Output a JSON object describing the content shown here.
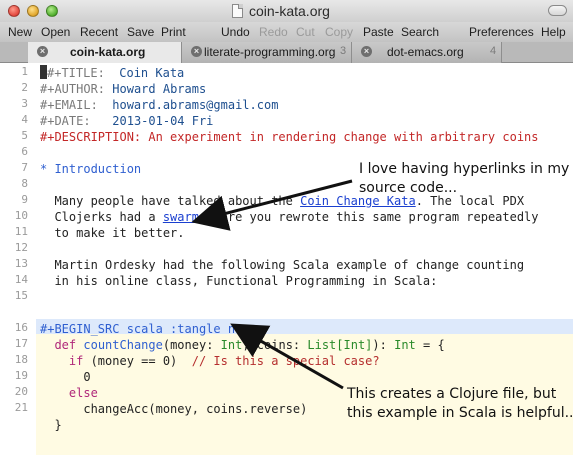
{
  "window": {
    "title": "coin-kata.org"
  },
  "toolbar": {
    "items": [
      {
        "label": "New",
        "enabled": true
      },
      {
        "label": "Open",
        "enabled": true
      },
      {
        "label": "Recent",
        "enabled": true
      },
      {
        "label": "Save",
        "enabled": true
      },
      {
        "label": "Print",
        "enabled": true
      },
      {
        "label": "Undo",
        "enabled": true
      },
      {
        "label": "Redo",
        "enabled": false
      },
      {
        "label": "Cut",
        "enabled": false
      },
      {
        "label": "Copy",
        "enabled": false
      },
      {
        "label": "Paste",
        "enabled": true
      },
      {
        "label": "Search",
        "enabled": true
      },
      {
        "label": "Preferences",
        "enabled": true
      },
      {
        "label": "Help",
        "enabled": true
      }
    ]
  },
  "tabs": [
    {
      "label": "coin-kata.org",
      "active": true,
      "number": ""
    },
    {
      "label": "literate-programming.org",
      "active": false,
      "number": "3"
    },
    {
      "label": "dot-emacs.org",
      "active": false,
      "number": "4"
    }
  ],
  "editor": {
    "line_numbers": [
      "1",
      "2",
      "3",
      "4",
      "5",
      "6",
      "7",
      "8",
      "9",
      "10",
      "11",
      "12",
      "13",
      "14",
      "15",
      "16",
      "17",
      "18",
      "19",
      "20",
      "21"
    ],
    "lines": {
      "l1_key": "#+TITLE:",
      "l1_val": "Coin Kata",
      "l2_key": "#+AUTHOR:",
      "l2_val": "Howard Abrams",
      "l3_key": "#+EMAIL:",
      "l3_val": "howard.abrams@gmail.com",
      "l4_key": "#+DATE:",
      "l4_val": "2013-01-04 Fri",
      "l5": "#+DESCRIPTION: An experiment in rendering change with arbitrary coins",
      "l7": "* Introduction",
      "l9_a": "  Many people have talked about the ",
      "l9_link": "Coin Change Kata",
      "l9_b": ". The local PDX",
      "l10_a": "  Clojerks had a ",
      "l10_link": "swarm",
      "l10_b": " where you rewrote this same program repeatedly",
      "l11": "  to make it better.",
      "l13": "  Martin Ordesky had the following Scala example of change counting",
      "l14": "  in his online class, Functional Programming in Scala:",
      "l16_begin": "#+BEGIN_SRC scala :tangle no",
      "l17_kw": "def",
      "l17_fn": "countChange",
      "l17_a": "(money: ",
      "l17_t1": "Int",
      "l17_b": ", coins: ",
      "l17_t2": "List[Int]",
      "l17_c": "): ",
      "l17_t3": "Int",
      "l17_d": " = {",
      "l18_kw": "if",
      "l18_a": " (money == 0)  ",
      "l18_cm": "// Is this a special case?",
      "l19": "0",
      "l20_kw": "else",
      "l21": "changeAcc(money, coins.reverse)",
      "l22": "}"
    }
  },
  "annotations": {
    "note_top_1": "I love having hyperlinks in my",
    "note_top_2": "source code...",
    "note_bottom_1": "This creates a Clojure file, but",
    "note_bottom_2": "this example in Scala is helpful.."
  }
}
